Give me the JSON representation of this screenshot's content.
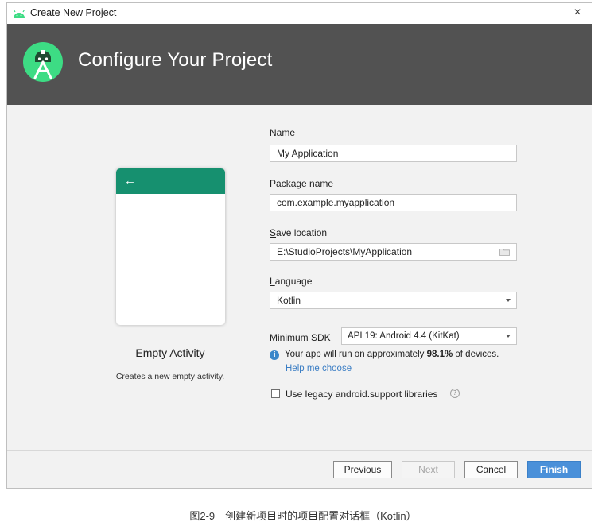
{
  "window": {
    "title": "Create New Project",
    "close_glyph": "×",
    "icon": "android-icon",
    "accent_color": "#3ddc84"
  },
  "banner": {
    "title": "Configure Your Project",
    "logo": "android-studio-logo",
    "background_color": "#525252"
  },
  "template": {
    "name": "Empty Activity",
    "description": "Creates a new empty activity.",
    "appbar_color": "#16906f",
    "back_glyph": "←"
  },
  "form": {
    "name": {
      "label_key": "N",
      "label_rest": "ame",
      "value": "My Application"
    },
    "package": {
      "label_key": "P",
      "label_rest": "ackage name",
      "value": "com.example.myapplication"
    },
    "save_location": {
      "label_key": "S",
      "label_rest": "ave location",
      "value": "E:\\StudioProjects\\MyApplication",
      "icon": "folder-icon"
    },
    "language": {
      "label_key": "L",
      "label_rest": "anguage",
      "value": "Kotlin",
      "icon": "chevron-down-icon"
    },
    "min_sdk": {
      "label": "Minimum SDK",
      "value": "API 19: Android 4.4 (KitKat)",
      "icon": "chevron-down-icon"
    },
    "info": {
      "icon": "info-icon",
      "glyph": "i",
      "text_before": "Your app will run on approximately ",
      "percent": "98.1%",
      "text_after": " of devices.",
      "help_link": "Help me choose"
    },
    "legacy": {
      "label": "Use legacy android.support libraries",
      "checked": false,
      "help_glyph": "?"
    }
  },
  "footer": {
    "previous": {
      "key": "P",
      "rest": "revious"
    },
    "next": "Next",
    "cancel": {
      "key": "C",
      "rest": "ancel"
    },
    "finish": {
      "key": "F",
      "rest": "inish"
    },
    "finish_color": "#4a90d9"
  },
  "caption": "图2-9　创建新项目时的项目配置对话框（Kotlin）"
}
